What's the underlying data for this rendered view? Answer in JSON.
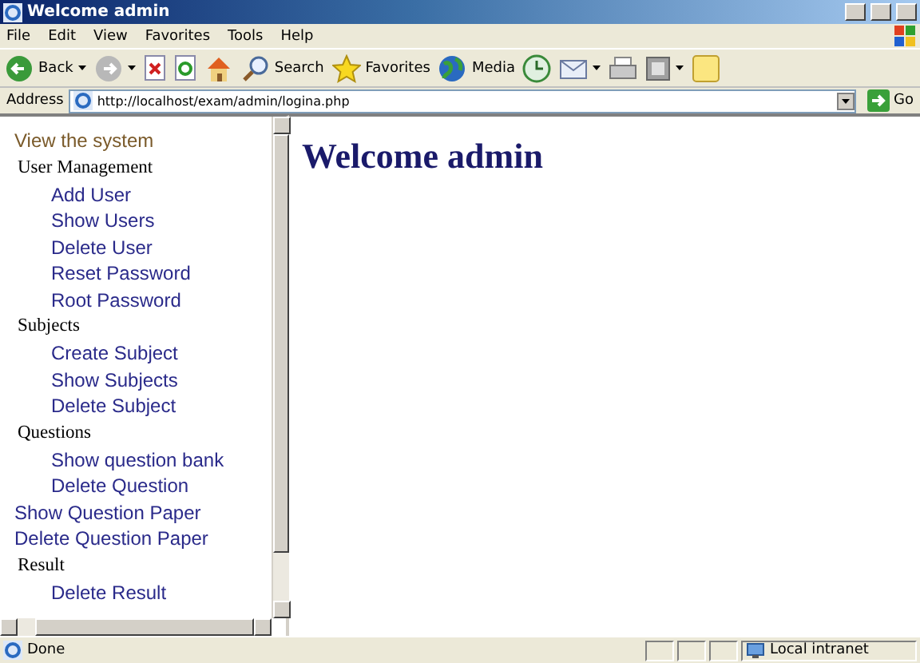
{
  "window": {
    "title": "Welcome admin"
  },
  "menu": [
    "File",
    "Edit",
    "View",
    "Favorites",
    "Tools",
    "Help"
  ],
  "toolbar": [
    {
      "kind": "back",
      "label": "Back",
      "dropdown": true
    },
    {
      "kind": "forward",
      "dropdown": true
    },
    {
      "kind": "stop"
    },
    {
      "kind": "refresh"
    },
    {
      "kind": "home"
    },
    {
      "kind": "search",
      "label": "Search"
    },
    {
      "kind": "favorites",
      "label": "Favorites"
    },
    {
      "kind": "media",
      "label": "Media"
    },
    {
      "kind": "history"
    },
    {
      "kind": "mail",
      "dropdown": true
    },
    {
      "kind": "print"
    },
    {
      "kind": "edit",
      "dropdown": true
    },
    {
      "kind": "note"
    }
  ],
  "address": {
    "label": "Address",
    "value": "http://localhost/exam/admin/logina.php",
    "go": "Go"
  },
  "sidebar": {
    "items": [
      {
        "kind": "link",
        "label": "View the system",
        "visited": true
      },
      {
        "kind": "heading",
        "label": "User Management",
        "children": [
          {
            "label": "Add User"
          },
          {
            "label": "Show Users"
          },
          {
            "label": "Delete User"
          },
          {
            "label": "Reset Password"
          },
          {
            "label": "Root Password"
          }
        ]
      },
      {
        "kind": "heading",
        "label": "Subjects",
        "children": [
          {
            "label": "Create Subject"
          },
          {
            "label": "Show Subjects"
          },
          {
            "label": "Delete Subject"
          }
        ]
      },
      {
        "kind": "heading",
        "label": "Questions",
        "children": [
          {
            "label": "Show question bank"
          },
          {
            "label": "Delete Question"
          }
        ]
      },
      {
        "kind": "link",
        "label": "Show Question Paper",
        "visited": false
      },
      {
        "kind": "link",
        "label": "Delete Question Paper",
        "visited": false
      },
      {
        "kind": "heading",
        "label": "Result",
        "children": [
          {
            "label": "Delete Result"
          }
        ]
      }
    ]
  },
  "main": {
    "heading": "Welcome admin"
  },
  "status_bar": {
    "text": "Done",
    "zone": "Local intranet"
  }
}
